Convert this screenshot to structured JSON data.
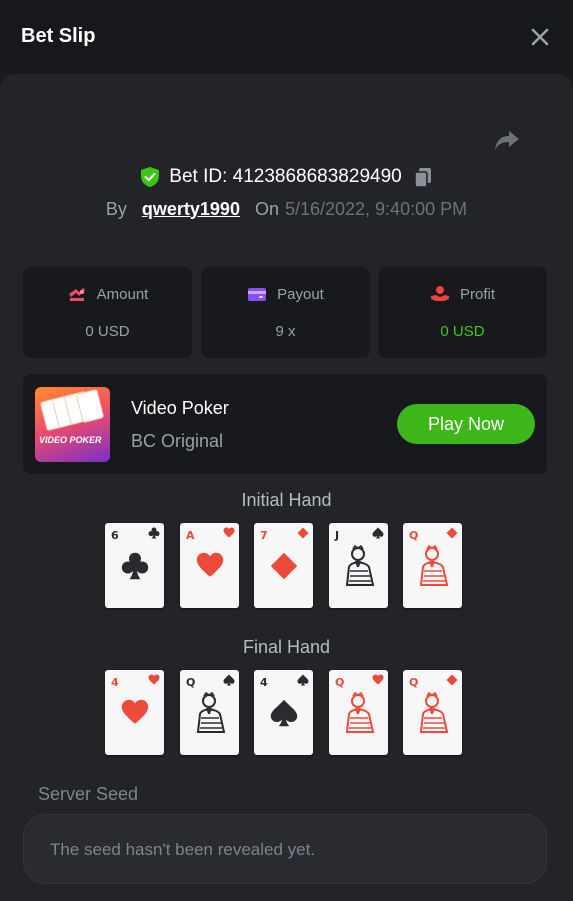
{
  "header": {
    "title": "Bet Slip"
  },
  "bet": {
    "id_text": "Bet ID: 4123868683829490",
    "by_label": "By",
    "username": "qwerty1990",
    "on_label": "On",
    "datetime": "5/16/2022, 9:40:00 PM"
  },
  "stats": [
    {
      "label": "Amount",
      "value": "0 USD",
      "icon": "amount-icon",
      "color": "#f24a6b"
    },
    {
      "label": "Payout",
      "value": "9 x",
      "icon": "wallet-icon",
      "color": "#8a4df0"
    },
    {
      "label": "Profit",
      "value": "0 USD",
      "icon": "profit-icon",
      "color": "#f2413f",
      "value_color": "#43c71b"
    }
  ],
  "game": {
    "name": "Video Poker",
    "subtitle": "BC Original",
    "play_label": "Play Now",
    "thumb_text": "VIDEO POKER"
  },
  "initial_hand": {
    "title": "Initial Hand",
    "cards": [
      {
        "rank": "6",
        "suit": "clubs"
      },
      {
        "rank": "A",
        "suit": "hearts"
      },
      {
        "rank": "7",
        "suit": "diamonds"
      },
      {
        "rank": "J",
        "suit": "spades"
      },
      {
        "rank": "Q",
        "suit": "diamonds"
      }
    ]
  },
  "final_hand": {
    "title": "Final Hand",
    "cards": [
      {
        "rank": "4",
        "suit": "hearts"
      },
      {
        "rank": "Q",
        "suit": "spades"
      },
      {
        "rank": "4",
        "suit": "spades"
      },
      {
        "rank": "Q",
        "suit": "hearts"
      },
      {
        "rank": "Q",
        "suit": "diamonds"
      }
    ]
  },
  "server_seed": {
    "label": "Server Seed",
    "value": "The seed hasn't been revealed yet."
  },
  "colors": {
    "accent_green": "#3db719",
    "shield_green": "#3fc31a",
    "red_suit": "#ee4a3b",
    "black_suit": "#2a2b30"
  }
}
